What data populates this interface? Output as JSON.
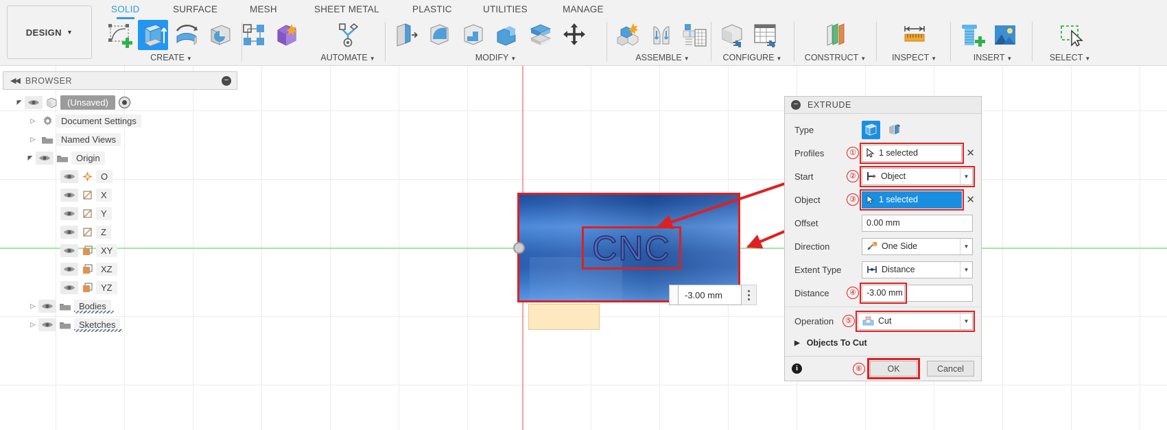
{
  "app": {
    "workspace_label": "DESIGN",
    "tabs": [
      {
        "label": "SOLID",
        "active": true
      },
      {
        "label": "SURFACE",
        "active": false
      },
      {
        "label": "MESH",
        "active": false
      },
      {
        "label": "SHEET METAL",
        "active": false
      },
      {
        "label": "PLASTIC",
        "active": false
      },
      {
        "label": "UTILITIES",
        "active": false
      },
      {
        "label": "MANAGE",
        "active": false
      }
    ],
    "ribbon_groups": [
      {
        "label": "CREATE",
        "icons": [
          "create-sketch-icon",
          "extrude-icon",
          "revolve-icon",
          "sweep-icon",
          "pattern-icon",
          "form-icon"
        ]
      },
      {
        "label": "AUTOMATE",
        "icons": [
          "automate-icon"
        ]
      },
      {
        "label": "MODIFY",
        "icons": [
          "press-pull-icon",
          "fillet-icon",
          "shell-icon",
          "combine-icon",
          "split-face-icon",
          "move-copy-icon"
        ]
      },
      {
        "label": "ASSEMBLE",
        "icons": [
          "new-component-icon",
          "joint-icon",
          "assemble-table-icon"
        ]
      },
      {
        "label": "CONFIGURE",
        "icons": [
          "configure-body-icon",
          "configure-table-icon"
        ]
      },
      {
        "label": "CONSTRUCT",
        "icons": [
          "offset-plane-icon"
        ]
      },
      {
        "label": "INSPECT",
        "icons": [
          "measure-icon"
        ]
      },
      {
        "label": "INSERT",
        "icons": [
          "insert-mcmaster-icon",
          "insert-image-icon"
        ]
      },
      {
        "label": "SELECT",
        "icons": [
          "select-window-icon"
        ]
      }
    ]
  },
  "browser": {
    "title": "BROWSER",
    "collapse_glyph": "◀◀",
    "minimize_glyph": "−",
    "items": [
      {
        "label": "(Unsaved)",
        "icon": "document-icon",
        "level": 0,
        "twisty": "expanded",
        "eye": true,
        "radio": true,
        "squiggle": false
      },
      {
        "label": "Document Settings",
        "icon": "gear-icon",
        "level": 1,
        "twisty": "collapsed",
        "eye": false,
        "radio": false,
        "squiggle": false
      },
      {
        "label": "Named Views",
        "icon": "folder-icon",
        "level": 1,
        "twisty": "collapsed",
        "eye": false,
        "radio": false,
        "squiggle": false
      },
      {
        "label": "Origin",
        "icon": "folder-icon",
        "level": 1,
        "twisty": "expanded",
        "eye": true,
        "radio": false,
        "squiggle": false
      },
      {
        "label": "O",
        "icon": "origin-point-icon",
        "level": 2,
        "twisty": "none",
        "eye": true,
        "radio": false,
        "squiggle": false
      },
      {
        "label": "X",
        "icon": "axis-icon",
        "level": 2,
        "twisty": "none",
        "eye": true,
        "radio": false,
        "squiggle": false
      },
      {
        "label": "Y",
        "icon": "axis-icon",
        "level": 2,
        "twisty": "none",
        "eye": true,
        "radio": false,
        "squiggle": false
      },
      {
        "label": "Z",
        "icon": "axis-icon",
        "level": 2,
        "twisty": "none",
        "eye": true,
        "radio": false,
        "squiggle": false
      },
      {
        "label": "XY",
        "icon": "plane-icon",
        "level": 2,
        "twisty": "none",
        "eye": true,
        "radio": false,
        "squiggle": false
      },
      {
        "label": "XZ",
        "icon": "plane-icon",
        "level": 2,
        "twisty": "none",
        "eye": true,
        "radio": false,
        "squiggle": false
      },
      {
        "label": "YZ",
        "icon": "plane-icon",
        "level": 2,
        "twisty": "none",
        "eye": true,
        "radio": false,
        "squiggle": false
      },
      {
        "label": "Bodies",
        "icon": "folder-icon",
        "level": 1,
        "twisty": "collapsed",
        "eye": true,
        "radio": false,
        "squiggle": true
      },
      {
        "label": "Sketches",
        "icon": "folder-icon",
        "level": 1,
        "twisty": "collapsed",
        "eye": true,
        "radio": false,
        "squiggle": true
      }
    ]
  },
  "viewport": {
    "body_text": "CNC",
    "manipulator_value": "-3.00 mm"
  },
  "extrude": {
    "title": "EXTRUDE",
    "collapse_glyph": "−",
    "fields": [
      {
        "label": "Type",
        "marker": "",
        "kind": "type-toggle",
        "value": "",
        "highlight": false
      },
      {
        "label": "Profiles",
        "marker": "①",
        "kind": "select",
        "value": "1 selected",
        "icon": "cursor-icon",
        "highlight": true,
        "blue": false,
        "clear": true
      },
      {
        "label": "Start",
        "marker": "②",
        "kind": "dropdown",
        "value": "Object",
        "icon": "start-object-icon",
        "highlight": true,
        "blue": false,
        "clear": false
      },
      {
        "label": "Object",
        "marker": "③",
        "kind": "select",
        "value": "1 selected",
        "icon": "cursor-icon",
        "highlight": true,
        "blue": true,
        "clear": true
      },
      {
        "label": "Offset",
        "marker": "",
        "kind": "text",
        "value": "0.00 mm",
        "icon": "",
        "highlight": false,
        "blue": false,
        "clear": false
      },
      {
        "label": "Direction",
        "marker": "",
        "kind": "dropdown",
        "value": "One Side",
        "icon": "one-side-icon",
        "highlight": false,
        "blue": false,
        "clear": false
      },
      {
        "label": "Extent Type",
        "marker": "",
        "kind": "dropdown",
        "value": "Distance",
        "icon": "distance-icon",
        "highlight": false,
        "blue": false,
        "clear": false
      },
      {
        "label": "Distance",
        "marker": "④",
        "kind": "text-short",
        "value": "-3.00 mm",
        "icon": "",
        "highlight": true,
        "blue": false,
        "clear": false
      },
      {
        "label": "Operation",
        "marker": "⑤",
        "kind": "dropdown",
        "value": "Cut",
        "icon": "cut-icon",
        "highlight": true,
        "blue": false,
        "clear": false
      }
    ],
    "objects_to_cut_label": "Objects To Cut",
    "objects_to_cut_glyph": "▶",
    "footer": {
      "info_glyph": "i",
      "marker": "⑥",
      "ok_label": "OK",
      "cancel_label": "Cancel"
    }
  },
  "colors": {
    "accent_blue": "#1a8fe0",
    "annotation_red": "#e02020",
    "tab_active": "#3399dd",
    "body_blue": "#2c62b4",
    "axis_x_green": "#9fe89f",
    "axis_y_red": "#f4a0a0",
    "sketch_plate": "#fde8bf"
  }
}
